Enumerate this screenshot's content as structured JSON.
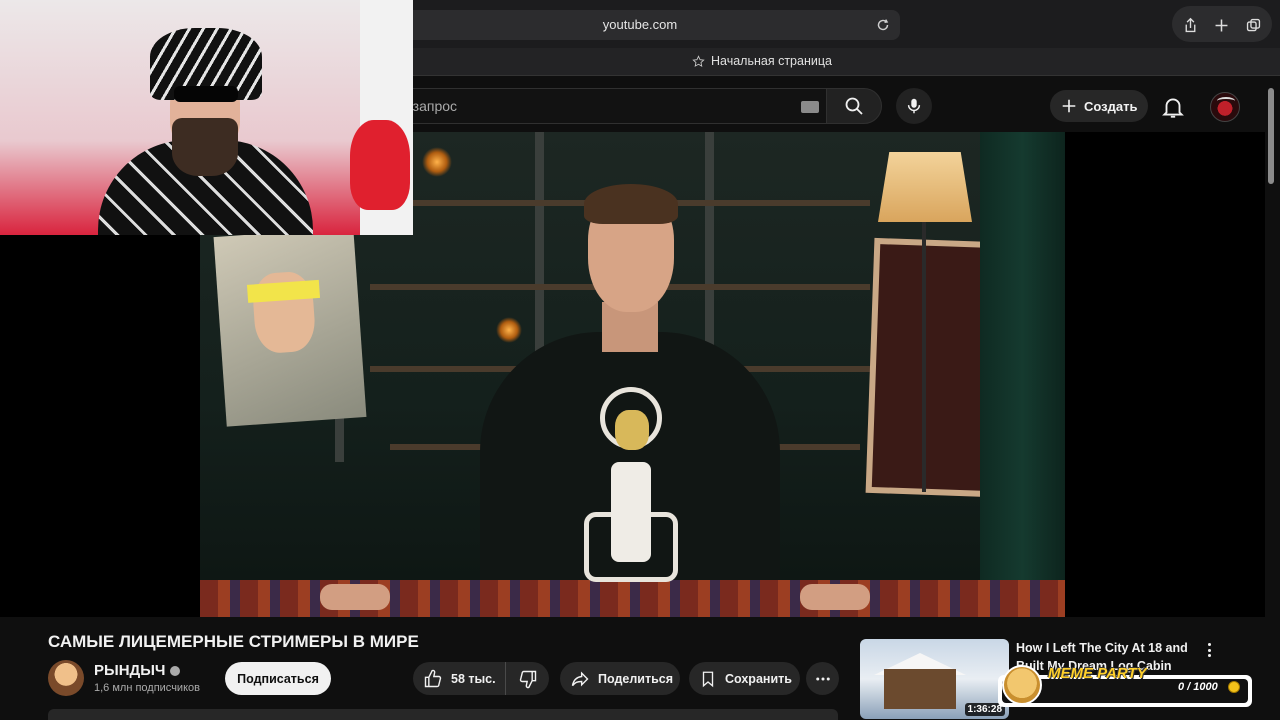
{
  "browser": {
    "url": "youtube.com",
    "bookmark_label": "Начальная страница"
  },
  "youtube": {
    "search_placeholder": "е запрос",
    "create_label": "Создать"
  },
  "video": {
    "title": "САМЫЕ ЛИЦЕМЕРНЫЕ СТРИМЕРЫ В МИРЕ",
    "channel_name": "РЫНДЫЧ",
    "subscribers": "1,6 млн подписчиков",
    "subscribe_label": "Подписаться",
    "likes": "58 тыс.",
    "share_label": "Поделиться",
    "save_label": "Сохранить"
  },
  "recommendation": {
    "title": "How I Left The City At 18 and Built My Dream Log Cabin",
    "duration": "1:36:28"
  },
  "overlay": {
    "meme_label": "MEME PARTY",
    "progress_text": "0 / 1000",
    "progress_fraction": 0
  },
  "colors": {
    "background": "#0f0f0f",
    "accent_yellow": "#ffd02a",
    "pill_bg": "#272727"
  },
  "icons": [
    "reload-icon",
    "share-icon",
    "new-tab-icon",
    "tabs-icon",
    "star-icon",
    "keyboard-icon",
    "search-icon",
    "mic-icon",
    "plus-icon",
    "bell-icon",
    "thumbs-up-icon",
    "thumbs-down-icon",
    "share-arrow-icon",
    "bookmark-icon",
    "more-icon",
    "kebab-icon",
    "coin-icon"
  ]
}
